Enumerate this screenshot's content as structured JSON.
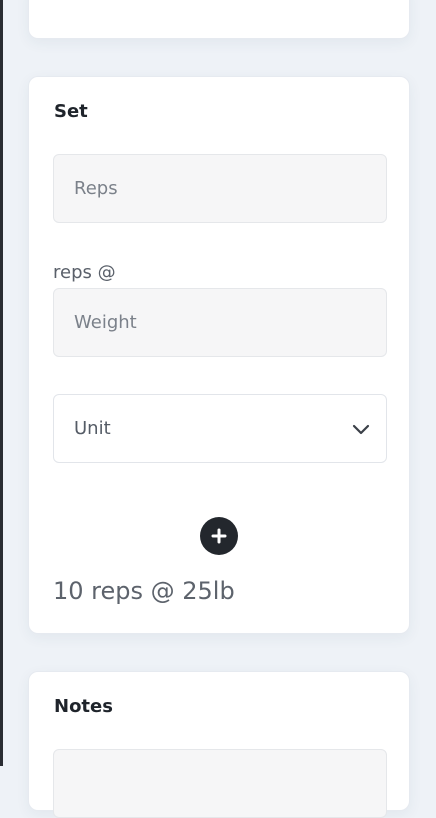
{
  "set_card": {
    "title": "Set",
    "reps_placeholder": "Reps",
    "reps_label": "reps @",
    "weight_placeholder": "Weight",
    "unit_selected": "Unit",
    "add_icon": "plus-circle-icon",
    "summary": "10 reps @ 25lb"
  },
  "notes_card": {
    "title": "Notes"
  },
  "colors": {
    "background": "#eef2f7",
    "card": "#ffffff",
    "input_fill": "#f6f6f7",
    "button": "#23272d"
  }
}
